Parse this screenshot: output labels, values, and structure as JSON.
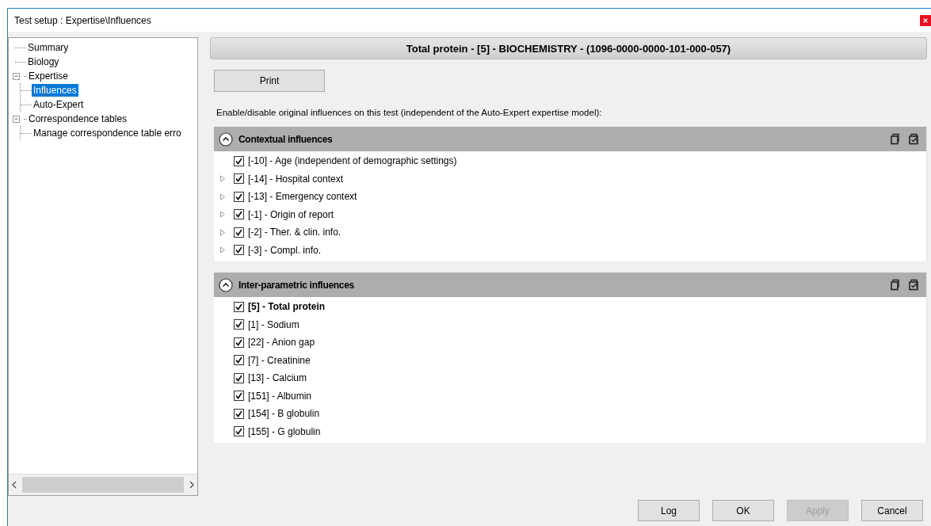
{
  "window": {
    "title": "Test setup : Expertise\\Influences"
  },
  "tree": {
    "items": [
      {
        "label": "Summary",
        "selected": false
      },
      {
        "label": "Biology",
        "selected": false
      },
      {
        "label": "Expertise",
        "selected": false,
        "expanded": true,
        "children": [
          {
            "label": "Influences",
            "selected": true
          },
          {
            "label": "Auto-Expert",
            "selected": false
          }
        ]
      },
      {
        "label": "Correspondence tables",
        "selected": false,
        "expanded": true,
        "children": [
          {
            "label": "Manage correspondence table erro",
            "selected": false
          }
        ]
      }
    ]
  },
  "header": {
    "title": "Total protein - [5] - BIOCHEMISTRY - (1096-0000-0000-101-000-057)"
  },
  "print_button": "Print",
  "description": "Enable/disable original influences on this test (independent of the Auto-Expert expertise model):",
  "sections": [
    {
      "title": "Contextual influences",
      "expanded": true,
      "items": [
        {
          "label": "[-10] - Age (independent of demographic settings)",
          "checked": true,
          "expandable": false,
          "emphasized": false
        },
        {
          "label": "[-14] - Hospital context",
          "checked": true,
          "expandable": true,
          "emphasized": false
        },
        {
          "label": "[-13] - Emergency context",
          "checked": true,
          "expandable": true,
          "emphasized": false
        },
        {
          "label": "[-1] - Origin of report",
          "checked": true,
          "expandable": true,
          "emphasized": false
        },
        {
          "label": "[-2] - Ther. & clin. info.",
          "checked": true,
          "expandable": true,
          "emphasized": false
        },
        {
          "label": "[-3] - Compl. info.",
          "checked": true,
          "expandable": true,
          "emphasized": false
        }
      ]
    },
    {
      "title": "Inter-parametric influences",
      "expanded": true,
      "items": [
        {
          "label": "[5] - Total protein",
          "checked": true,
          "expandable": false,
          "emphasized": true
        },
        {
          "label": "[1] - Sodium",
          "checked": true,
          "expandable": false,
          "emphasized": false
        },
        {
          "label": "[22] - Anion gap",
          "checked": true,
          "expandable": false,
          "emphasized": false
        },
        {
          "label": "[7] - Creatinine",
          "checked": true,
          "expandable": false,
          "emphasized": false
        },
        {
          "label": "[13] - Calcium",
          "checked": true,
          "expandable": false,
          "emphasized": false
        },
        {
          "label": "[151] - Albumin",
          "checked": true,
          "expandable": false,
          "emphasized": false
        },
        {
          "label": "[154] - B globulin",
          "checked": true,
          "expandable": false,
          "emphasized": false
        },
        {
          "label": "[155] - G globulin",
          "checked": true,
          "expandable": false,
          "emphasized": false
        }
      ]
    }
  ],
  "buttons": [
    {
      "label": "Log",
      "disabled": false
    },
    {
      "label": "OK",
      "disabled": false
    },
    {
      "label": "Apply",
      "disabled": true
    },
    {
      "label": "Cancel",
      "disabled": false
    }
  ]
}
